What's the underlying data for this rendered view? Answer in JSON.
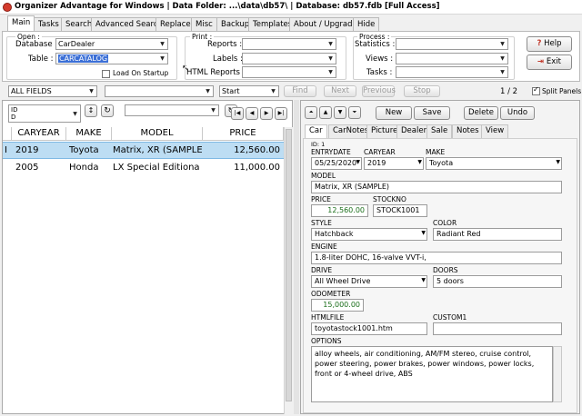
{
  "window": {
    "title": "Organizer Advantage for Windows | Data Folder: ...\\data\\db57\\ | Database: db57.fdb [Full Access]"
  },
  "tabs": [
    "Main",
    "Tasks",
    "Search",
    "Advanced Search",
    "Replace",
    "Misc",
    "Backup",
    "Templates",
    "About / Upgrade",
    "Hide"
  ],
  "open": {
    "title": "Open :",
    "database_label": "Database :",
    "database_value": "CarDealer",
    "table_label": "Table :",
    "table_value": "CARCATALOG",
    "load_on_startup": "Load On Startup"
  },
  "print": {
    "title": "Print :",
    "reports": "Reports :",
    "labels": "Labels :",
    "html_reports": "HTML Reports :"
  },
  "process": {
    "title": "Process :",
    "statistics": "Statistics :",
    "views": "Views :",
    "tasks": "Tasks :"
  },
  "help": {
    "help": "Help",
    "exit": "Exit"
  },
  "search": {
    "field": "ALL FIELDS",
    "mode": "Start",
    "find": "Find",
    "next": "Next",
    "previous": "Previous",
    "stop": "Stop",
    "page": "1 / 2",
    "split": "Split Panels"
  },
  "grid": {
    "sort_field_line1": "ID",
    "sort_field_line2": "D",
    "columns": [
      "CARYEAR",
      "MAKE",
      "MODEL",
      "PRICE"
    ],
    "rows": [
      {
        "marker": "I",
        "year": "2019",
        "make": "Toyota",
        "model": "Matrix, XR (SAMPLE)",
        "price": "12,560.00"
      },
      {
        "marker": "",
        "year": "2005",
        "make": "Honda",
        "model": "LX Special Editiona (S",
        "price": "11,000.00"
      }
    ]
  },
  "record": {
    "new": "New",
    "save": "Save",
    "delete": "Delete",
    "undo": "Undo",
    "tabs": [
      "Car",
      "CarNotes",
      "Picture",
      "Dealer",
      "Sale",
      "Notes",
      "View"
    ],
    "id_label": "ID: 1",
    "entrydate_label": "ENTRYDATE",
    "entrydate": "05/25/2020",
    "caryear_label": "CARYEAR",
    "caryear": "2019",
    "make_label": "MAKE",
    "make": "Toyota",
    "model_label": "MODEL",
    "model": "Matrix, XR (SAMPLE)",
    "price_label": "PRICE",
    "price": "12,560.00",
    "stockno_label": "STOCKNO",
    "stockno": "STOCK1001",
    "style_label": "STYLE",
    "style": "Hatchback",
    "color_label": "COLOR",
    "color": "Radiant Red",
    "engine_label": "ENGINE",
    "engine": "1.8-liter DOHC, 16-valve VVT-i,",
    "drive_label": "DRIVE",
    "drive": "All Wheel Drive",
    "doors_label": "DOORS",
    "doors": "5 doors",
    "odometer_label": "ODOMETER",
    "odometer": "15,000.00",
    "htmlfile_label": "HTMLFILE",
    "htmlfile": "toyotastock1001.htm",
    "custom1_label": "CUSTOM1",
    "custom1": "",
    "options_label": "OPTIONS",
    "options": "alloy wheels, air conditioning, AM/FM stereo, cruise control, power steering, power brakes, power windows, power locks, front or 4-wheel drive, ABS"
  },
  "colors": {
    "selected_row": "#bdddf3",
    "table_highlight": "#3b6fd6",
    "money": "#1a6e1a"
  }
}
